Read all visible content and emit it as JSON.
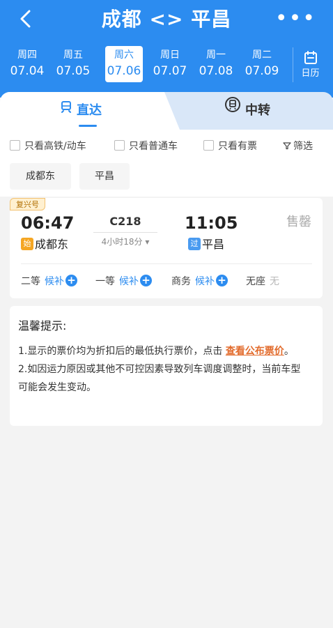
{
  "header": {
    "title": "成都 <> 平昌",
    "colors": {
      "primary": "#2c8cf0",
      "white": "#ffffff"
    },
    "back_icon": "chevron-left-icon",
    "more_label": "•••"
  },
  "dates": [
    {
      "weekday": "周四",
      "date": "07.04",
      "active": false
    },
    {
      "weekday": "周五",
      "date": "07.05",
      "active": false
    },
    {
      "weekday": "周六",
      "date": "07.06",
      "active": true
    },
    {
      "weekday": "周日",
      "date": "07.07",
      "active": false
    },
    {
      "weekday": "周一",
      "date": "07.08",
      "active": false
    },
    {
      "weekday": "周二",
      "date": "07.09",
      "active": false
    }
  ],
  "calendar": {
    "label": "日历",
    "icon": "calendar-icon"
  },
  "tabs": {
    "direct": {
      "label": "直达",
      "icon": "train-icon"
    },
    "transfer": {
      "label": "中转",
      "icon": "transfer-icon"
    }
  },
  "filters": {
    "high_speed": "只看高铁/动车",
    "normal": "只看普通车",
    "available": "只看有票",
    "filter_button": "筛选"
  },
  "station_chips": [
    "成都东",
    "平昌"
  ],
  "train": {
    "badge": "复兴号",
    "departure_time": "06:47",
    "arrival_time": "11:05",
    "train_number": "C218",
    "duration": "4小时18分 ▾",
    "status": "售罄",
    "departure_station": {
      "tag": "始",
      "name": "成都东"
    },
    "arrival_station": {
      "tag": "过",
      "name": "平昌"
    },
    "seats": [
      {
        "class": "二等",
        "status": "候补",
        "waitlist": true
      },
      {
        "class": "一等",
        "status": "候补",
        "waitlist": true
      },
      {
        "class": "商务",
        "status": "候补",
        "waitlist": true
      },
      {
        "class": "无座",
        "status": "无",
        "waitlist": false
      }
    ],
    "status_colors": {
      "waitlist": "#2c8cf0",
      "none": "#b8b8b8",
      "soldout": "#aaaaaa"
    }
  },
  "notice": {
    "title": "温馨提示:",
    "line1_prefix": "1.显示的票价均为折扣后的最低执行票价，点击 ",
    "line1_link": "查看公布票价",
    "line1_suffix": "。",
    "line2": "2.如因运力原因或其他不可控因素导致列车调度调整时，当前车型可能会发生变动。",
    "link_color": "#e26b2c"
  }
}
